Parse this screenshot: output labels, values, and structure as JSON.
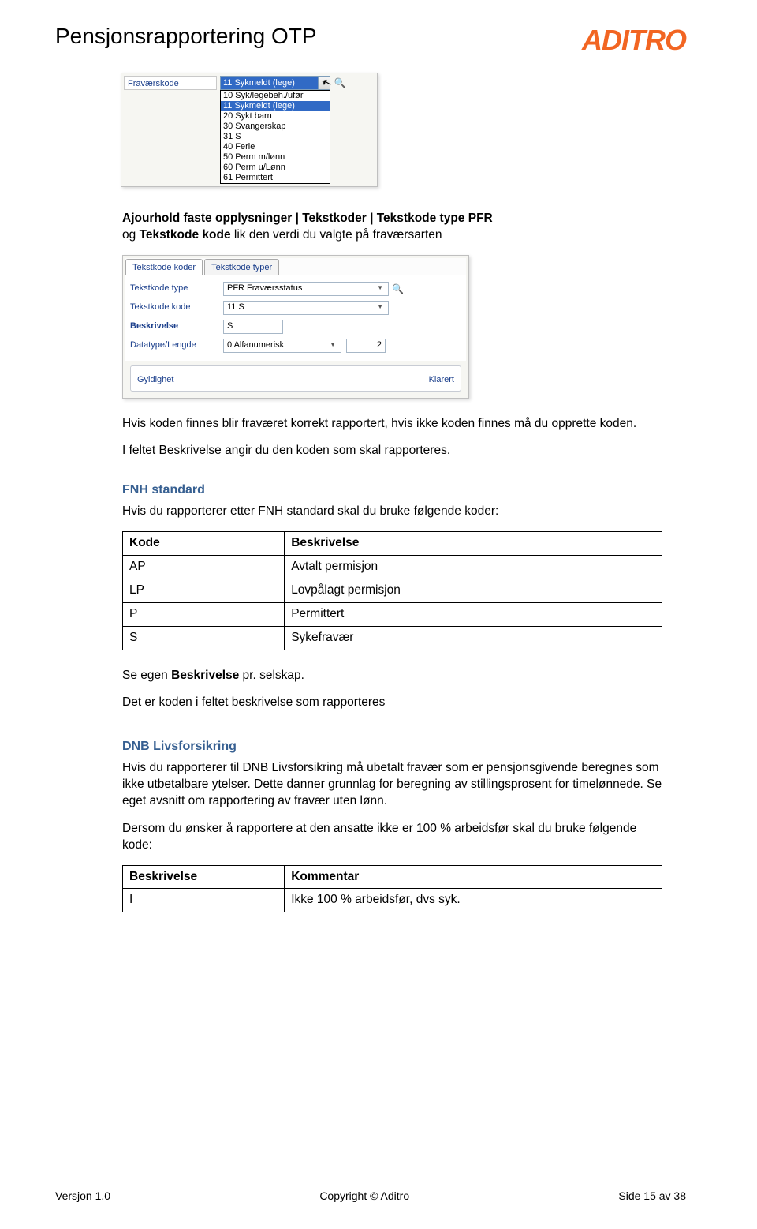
{
  "header": {
    "title": "Pensjonsrapportering OTP",
    "logo": "ADITRO"
  },
  "shot1": {
    "label": "Fraværskode",
    "selected": "11 Sykmeldt (lege)",
    "options": [
      "10 Syk/legebeh./ufør",
      "11 Sykmeldt (lege)",
      "20 Sykt barn",
      "30 Svangerskap",
      "31 S",
      "40 Ferie",
      "50 Perm m/lønn",
      "60 Perm u/Lønn",
      "61 Permittert"
    ],
    "highlightIndex": 1
  },
  "intro": {
    "p1a": "Ajourhold faste opplysninger | Tekstkoder | Tekstkode type PFR",
    "p1b": "og ",
    "p1c": "Tekstkode kode",
    "p1d": " lik den verdi du valgte på fraværsarten"
  },
  "shot2": {
    "tab1": "Tekstkode koder",
    "tab2": "Tekstkode typer",
    "rows": {
      "type_lbl": "Tekstkode type",
      "type_val": "PFR Fraværsstatus",
      "kode_lbl": "Tekstkode kode",
      "kode_val": "11 S",
      "beskr_lbl": "Beskrivelse",
      "beskr_val": "S",
      "data_lbl": "Datatype/Lengde",
      "data_val": "0 Alfanumerisk",
      "data_len": "2"
    },
    "fs_left": "Gyldighet",
    "fs_right": "Klarert"
  },
  "body": {
    "p2": "Hvis koden finnes blir fraværet korrekt rapportert, hvis ikke koden finnes må du opprette koden.",
    "p3": "I feltet Beskrivelse angir du den koden som skal rapporteres.",
    "fnh_h": "FNH standard",
    "fnh_p": "Hvis du rapporterer etter FNH standard skal du bruke følgende koder:",
    "fnh_table": {
      "h1": "Kode",
      "h2": "Beskrivelse",
      "rows": [
        [
          "AP",
          "Avtalt permisjon"
        ],
        [
          "LP",
          "Lovpålagt permisjon"
        ],
        [
          "P",
          "Permittert"
        ],
        [
          "S",
          "Sykefravær"
        ]
      ]
    },
    "p4a": "Se egen ",
    "p4b": "Beskrivelse",
    "p4c": " pr. selskap.",
    "p5": "Det er koden i feltet beskrivelse som rapporteres",
    "dnb_h": "DNB Livsforsikring",
    "dnb_p1": "Hvis du rapporterer til DNB Livsforsikring må ubetalt fravær som er pensjonsgivende beregnes som ikke utbetalbare ytelser. Dette danner grunnlag for beregning av stillingsprosent for timelønnede. Se eget avsnitt om rapportering av fravær uten lønn.",
    "dnb_p2": "Dersom du ønsker å rapportere at den ansatte ikke er 100 % arbeidsfør skal du bruke følgende kode:",
    "dnb_table": {
      "h1": "Beskrivelse",
      "h2": "Kommentar",
      "rows": [
        [
          "I",
          "Ikke 100 % arbeidsfør, dvs syk."
        ]
      ]
    }
  },
  "footer": {
    "left": "Versjon 1.0",
    "center": "Copyright © Aditro",
    "right": "Side 15 av 38"
  }
}
